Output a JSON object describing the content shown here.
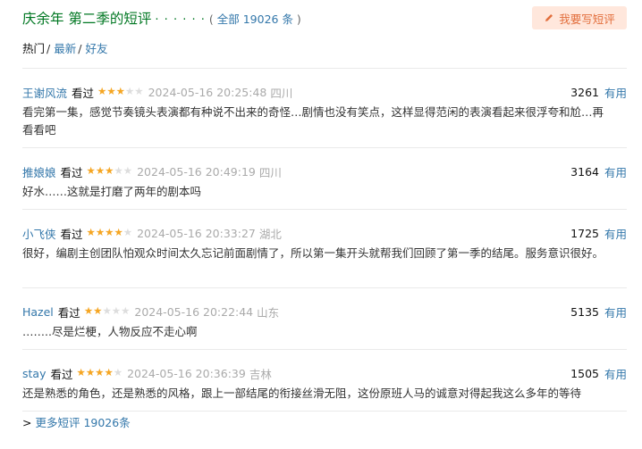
{
  "header": {
    "title": "庆余年 第二季的短评",
    "dots": "· · · · · ·",
    "count_open": "( ",
    "count_link": "全部 19026 条",
    "count_close": " )",
    "write_label": "我要写短评"
  },
  "tabs": [
    {
      "label": "热门",
      "active": true
    },
    {
      "label": "最新",
      "active": false
    },
    {
      "label": "好友",
      "active": false
    }
  ],
  "tab_separator": "/",
  "comments": [
    {
      "user": "王谢风流",
      "status": "看过",
      "rating": 3,
      "time": "2024-05-16 20:25:48",
      "location": "四川",
      "votes": "3261",
      "useful": "有用",
      "content": "看完第一集，感觉节奏镜头表演都有种说不出来的奇怪…剧情也没有笑点，这样显得范闲的表演看起来很浮夸和尬…再看看吧"
    },
    {
      "user": "推娘娘",
      "status": "看过",
      "rating": 3,
      "time": "2024-05-16 20:49:19",
      "location": "四川",
      "votes": "3164",
      "useful": "有用",
      "content": "好水……这就是打磨了两年的剧本吗"
    },
    {
      "user": "小飞侠",
      "status": "看过",
      "rating": 4,
      "time": "2024-05-16 20:33:27",
      "location": "湖北",
      "votes": "1725",
      "useful": "有用",
      "content": "很好，编剧主创团队怕观众时间太久忘记前面剧情了，所以第一集开头就帮我们回顾了第一季的结尾。服务意识很好。"
    },
    {
      "user": "Hazel",
      "status": "看过",
      "rating": 2,
      "time": "2024-05-16 20:22:44",
      "location": "山东",
      "votes": "5135",
      "useful": "有用",
      "content": "……..尽是烂梗，人物反应不走心啊"
    },
    {
      "user": "stay",
      "status": "看过",
      "rating": 4,
      "time": "2024-05-16 20:36:39",
      "location": "吉林",
      "votes": "1505",
      "useful": "有用",
      "content": "还是熟悉的角色，还是熟悉的风格，跟上一部结尾的衔接丝滑无阻，这份原班人马的诚意对得起我这么多年的等待"
    }
  ],
  "more": {
    "arrow": ">",
    "label": "更多短评 19026条"
  },
  "colors": {
    "title_green": "#007722",
    "link_blue": "#3377aa",
    "star_gold": "#f5a623",
    "button_bg": "#ffe7dc",
    "button_text": "#e26e3c"
  }
}
